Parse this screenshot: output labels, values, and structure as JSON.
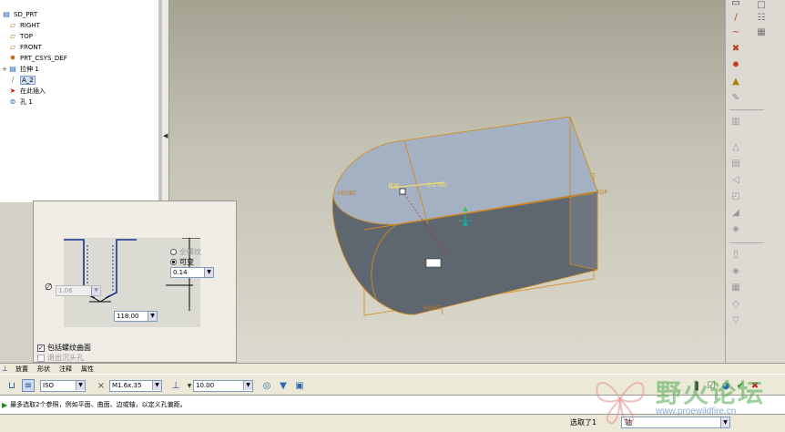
{
  "model_tree": {
    "items": [
      {
        "label": "SD_PRT",
        "icon": "part-icon",
        "indent": 0,
        "twisty": ""
      },
      {
        "label": "RIGHT",
        "icon": "datum-plane-icon",
        "indent": 1,
        "twisty": ""
      },
      {
        "label": "TOP",
        "icon": "datum-plane-icon",
        "indent": 1,
        "twisty": ""
      },
      {
        "label": "FRONT",
        "icon": "datum-plane-icon",
        "indent": 1,
        "twisty": ""
      },
      {
        "label": "PRT_CSYS_DEF",
        "icon": "coordinate-system-icon",
        "indent": 1,
        "twisty": ""
      },
      {
        "label": "拉伸 1",
        "icon": "extrude-icon",
        "indent": 1,
        "twisty": "+"
      },
      {
        "label": "A_2",
        "icon": "datum-axis-icon",
        "indent": 1,
        "twisty": "",
        "selected": true
      },
      {
        "label": "在此插入",
        "icon": "insert-here-icon",
        "indent": 1,
        "twisty": ""
      },
      {
        "label": "孔 1",
        "icon": "hole-icon",
        "indent": 1,
        "twisty": ""
      }
    ]
  },
  "viewport": {
    "labels": {
      "front": "FRONT",
      "top": "TOP",
      "right": "RIGHT",
      "dim_axis": "直径",
      "dim_value": "0.2 ISO"
    }
  },
  "hole_panel": {
    "diameter_value": "1.06",
    "radio_full_thread": "全螺纹",
    "radio_variable": "可变",
    "depth_value": "0.14",
    "angle_value": "118.00",
    "check_include_thread": "包括螺纹曲面",
    "check_exit_countersink": "退出沉头孔"
  },
  "tabs": [
    "放置",
    "形状",
    "注释",
    "属性"
  ],
  "dashboard": {
    "standard_value": "ISO",
    "screw_size_value": "M1.6x.35",
    "depth_value": "10.00"
  },
  "message": "最多选取2个参照，例如平面、曲面、边或轴，以定义孔偏距。",
  "status": {
    "selected_label": "选取了1",
    "filter_value": "轴"
  },
  "watermark": {
    "text": "野火论坛",
    "url": "www.proewildfire.cn"
  }
}
